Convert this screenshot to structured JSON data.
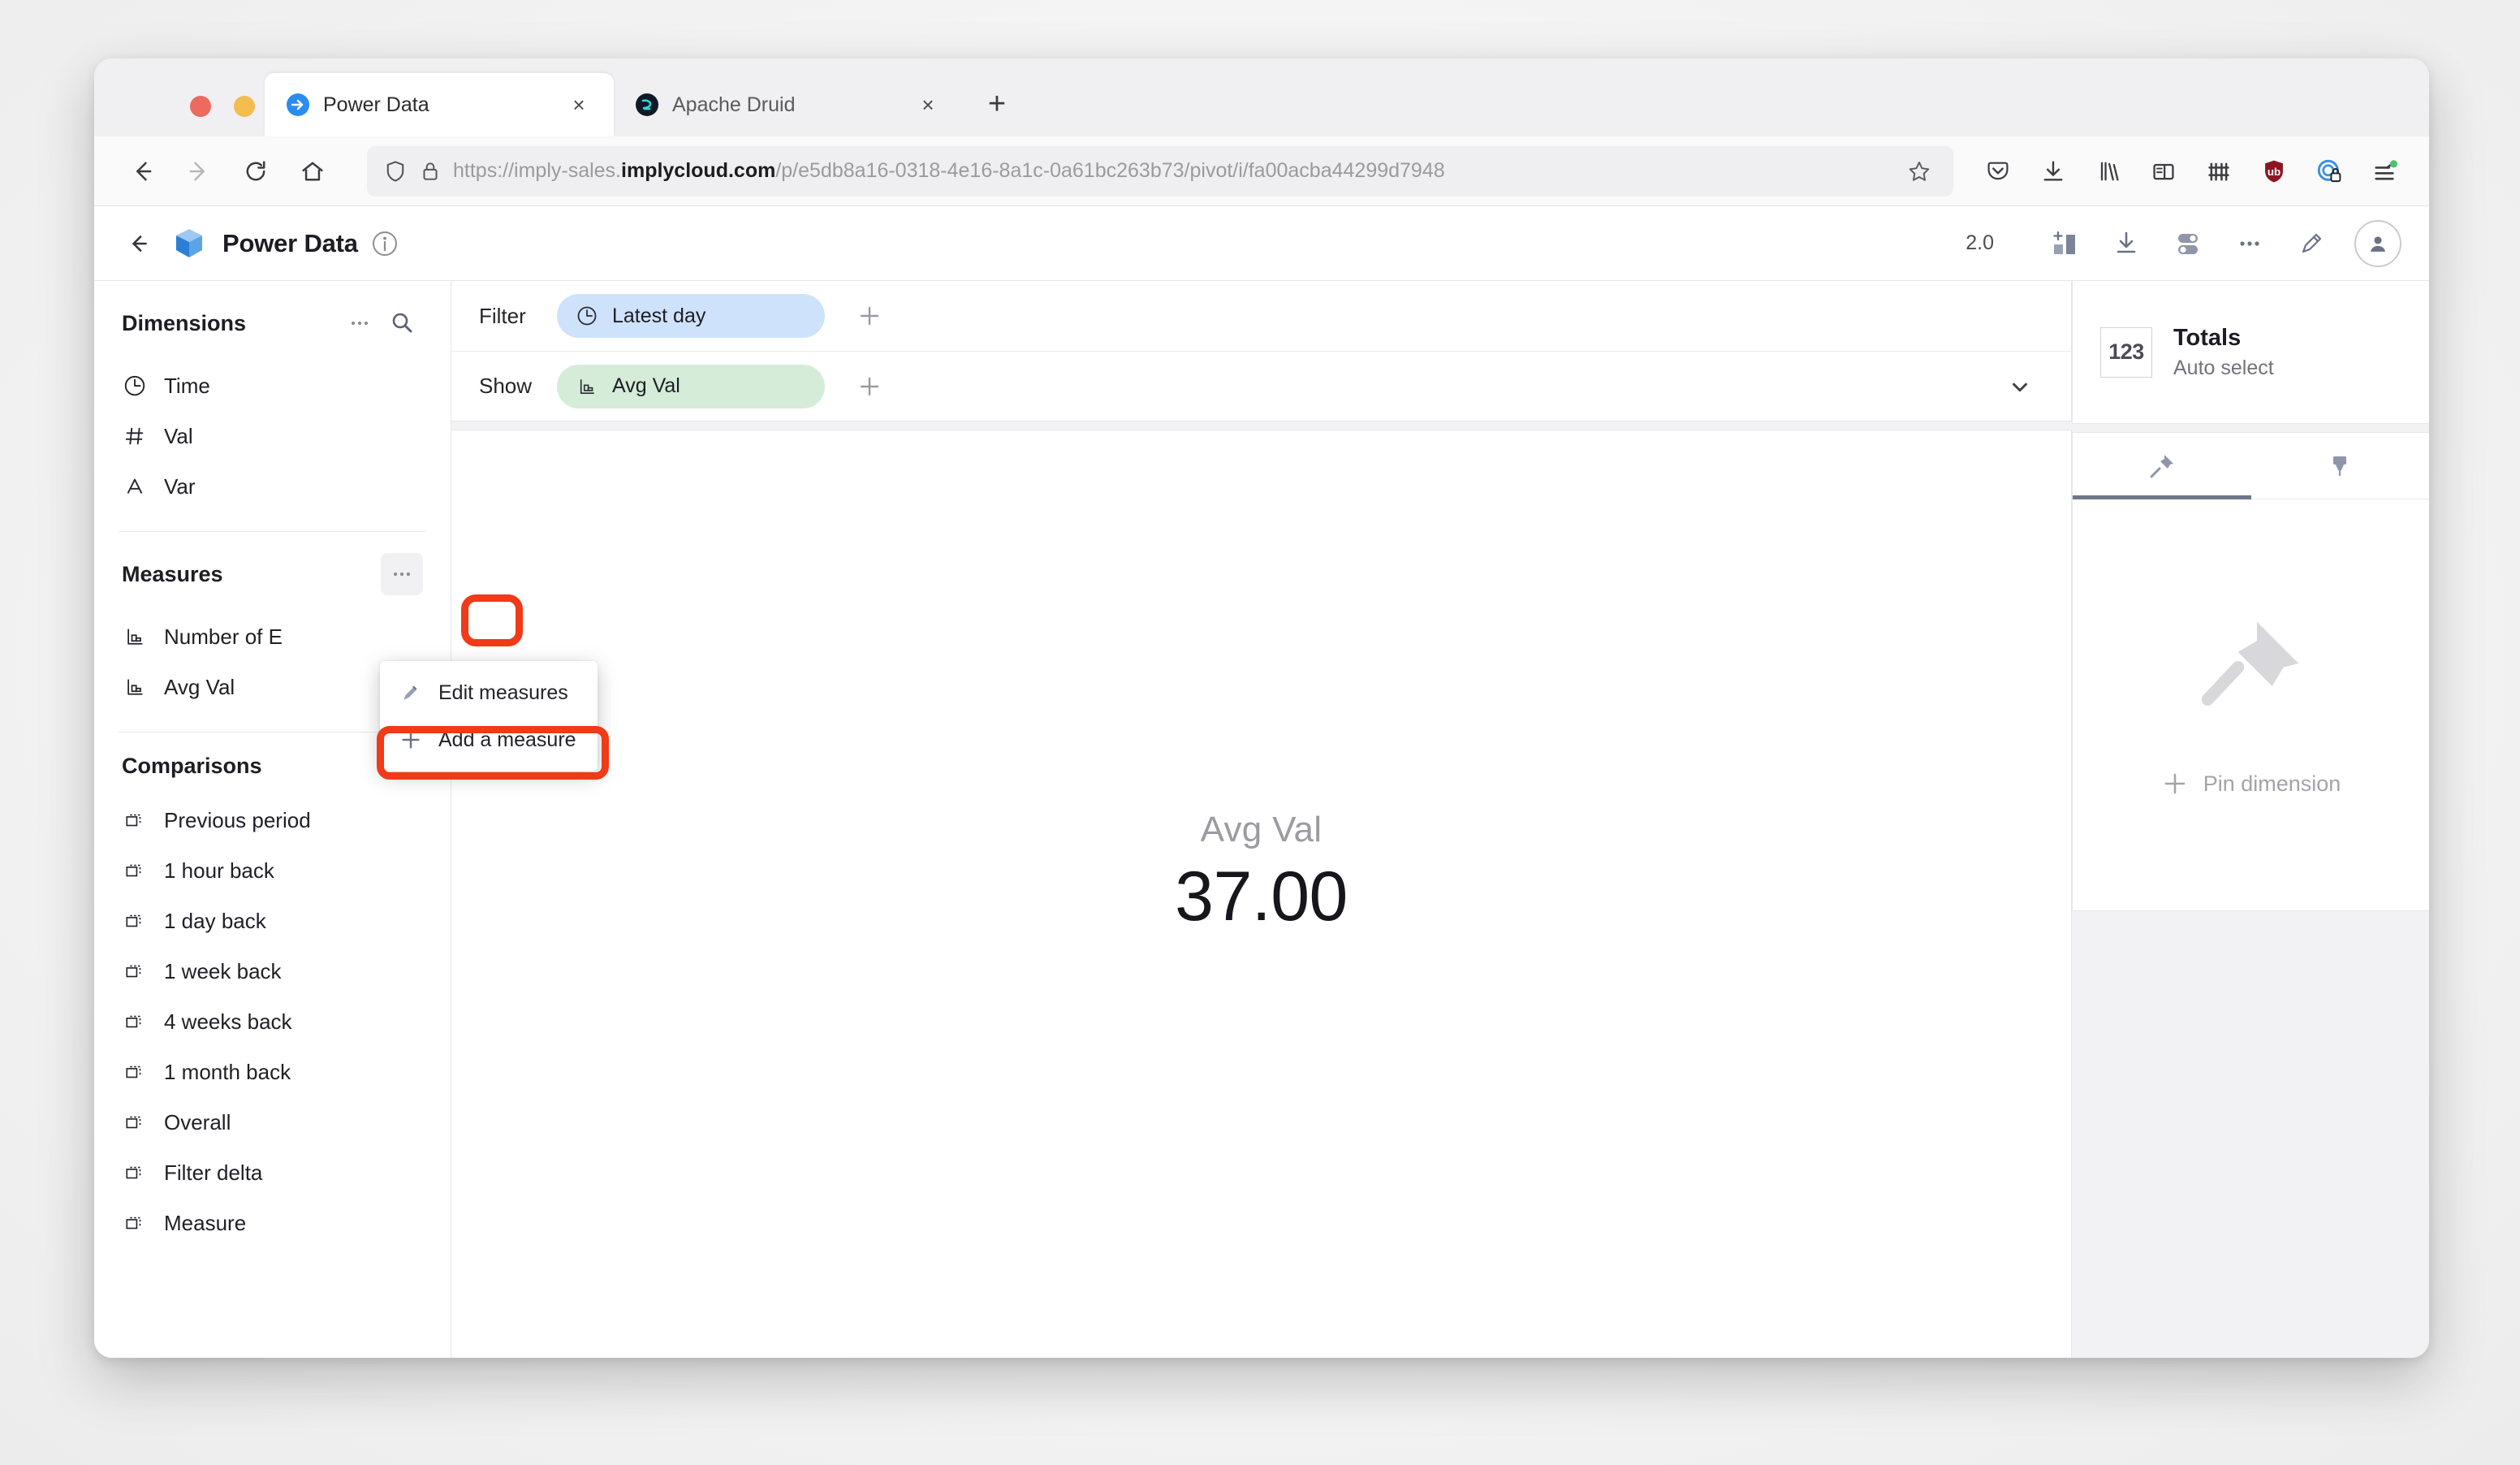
{
  "browser": {
    "tabs": [
      {
        "title": "Power Data",
        "favicon": "pivot-favicon",
        "active": true
      },
      {
        "title": "Apache Druid",
        "favicon": "druid-favicon",
        "active": false
      }
    ],
    "new_tab_label": "+",
    "close_label": "×",
    "nav": {
      "back": "back-arrow",
      "forward": "forward-arrow",
      "reload": "reload",
      "home": "home"
    },
    "url": {
      "prefix": "https://imply-sales.",
      "domain": "implycloud.com",
      "suffix": "/p/e5db8a16-0318-4e16-8a1c-0a61bc263b73/pivot/i/fa00acba44299d7948",
      "full": "https://imply-sales.implycloud.com/p/e5db8a16-0318-4e16-8a1c-0a61bc263b73/pivot/i/fa00acba44299d7948"
    },
    "extensions": [
      "pocket-icon",
      "downloads-icon",
      "library-icon",
      "sidebar-icon",
      "containers-icon",
      "ublock-icon",
      "privacy-icon",
      "app-menu-icon"
    ]
  },
  "app": {
    "back_label": "←",
    "title": "Power Data",
    "version": "2.0",
    "toolbar_icons": [
      "add-tile-icon",
      "download-icon",
      "settings-toggle-icon",
      "more-icon",
      "edit-pencil-icon",
      "user-avatar-icon"
    ]
  },
  "sidebar": {
    "dimensions": {
      "title": "Dimensions",
      "more_label": "•••",
      "items": [
        {
          "label": "Time",
          "icon": "clock-icon"
        },
        {
          "label": "Val",
          "icon": "hash-icon"
        },
        {
          "label": "Var",
          "icon": "letter-a-icon"
        }
      ]
    },
    "measures": {
      "title": "Measures",
      "more_label": "•••",
      "items": [
        {
          "label": "Number of E",
          "icon": "measure-icon"
        },
        {
          "label": "Avg Val",
          "icon": "measure-icon"
        }
      ]
    },
    "comparisons": {
      "title": "Comparisons",
      "items": [
        {
          "label": "Previous period",
          "icon": "compare-icon"
        },
        {
          "label": "1 hour back",
          "icon": "compare-icon"
        },
        {
          "label": "1 day back",
          "icon": "compare-icon"
        },
        {
          "label": "1 week back",
          "icon": "compare-icon"
        },
        {
          "label": "4 weeks back",
          "icon": "compare-icon"
        },
        {
          "label": "1 month back",
          "icon": "compare-icon"
        },
        {
          "label": "Overall",
          "icon": "compare-icon"
        },
        {
          "label": "Filter delta",
          "icon": "compare-icon"
        },
        {
          "label": "Measure",
          "icon": "compare-icon"
        }
      ]
    }
  },
  "popup": {
    "items": [
      {
        "label": "Edit measures",
        "icon": "pencil-icon"
      },
      {
        "label": "Add a measure",
        "icon": "plus-icon"
      }
    ]
  },
  "highlight": {
    "color": "#f03a18"
  },
  "filterbar": {
    "filter_label": "Filter",
    "filter_pill": {
      "label": "Latest day",
      "icon": "clock-icon",
      "color": "#cfe2fb"
    },
    "show_label": "Show",
    "show_pill": {
      "label": "Avg Val",
      "icon": "measure-icon",
      "color": "#d4ecd8"
    },
    "add_label": "+",
    "chevron_label": "chevron-down-icon"
  },
  "visualization": {
    "title": "Avg Val",
    "value": "37.00"
  },
  "rightbar": {
    "totals": {
      "badge": "123",
      "title": "Totals",
      "subtitle": "Auto select"
    },
    "tabs": [
      {
        "icon": "pin-icon",
        "active": true
      },
      {
        "icon": "highlighter-icon",
        "active": false
      }
    ],
    "empty": {
      "icon": "pin-large-icon",
      "add_label": "Pin dimension",
      "add_icon": "plus-icon"
    }
  }
}
